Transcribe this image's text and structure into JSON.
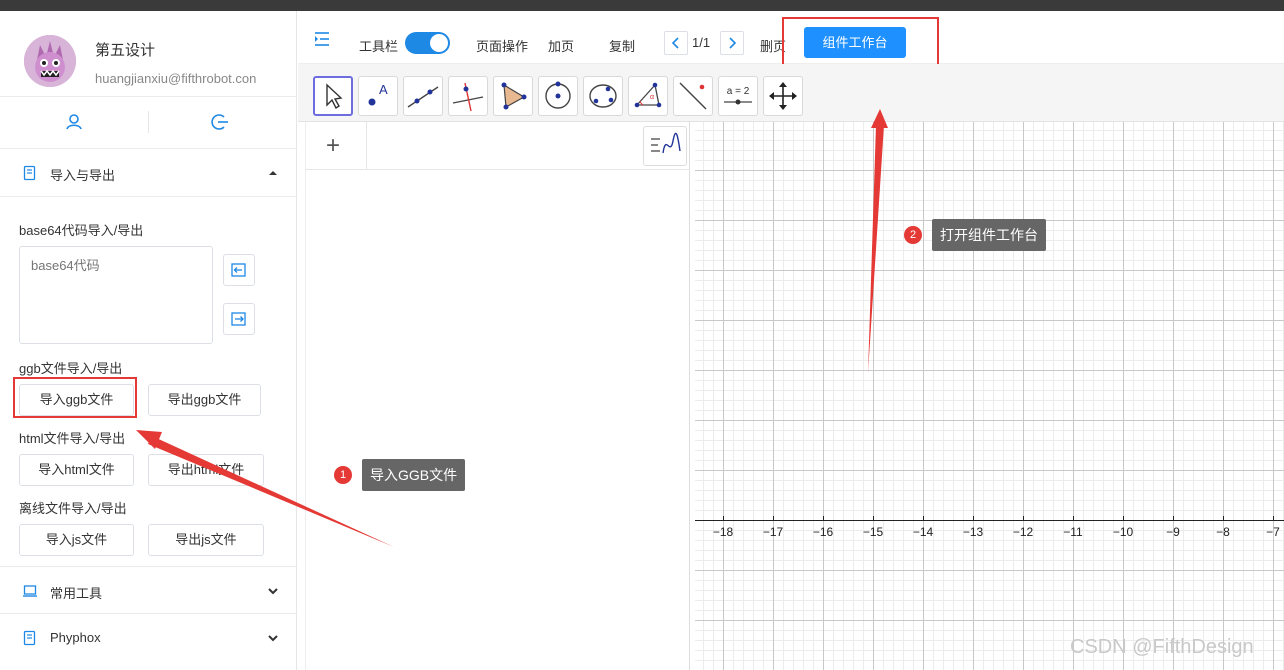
{
  "profile": {
    "name": "第五设计",
    "email": "huangjianxiu@fifthrobot.con"
  },
  "sidebar": {
    "import_export_title": "导入与导出",
    "base64_label": "base64代码导入/导出",
    "base64_placeholder": "base64代码",
    "ggb_label": "ggb文件导入/导出",
    "import_ggb": "导入ggb文件",
    "export_ggb": "导出ggb文件",
    "html_label": "html文件导入/导出",
    "import_html": "导入html文件",
    "export_html": "导出html文件",
    "offline_label": "离线文件导入/导出",
    "import_js": "导入js文件",
    "export_js": "导出js文件",
    "common_tools": "常用工具",
    "phyphox": "Phyphox"
  },
  "toolbar": {
    "toolbar_label": "工具栏",
    "page_ops": "页面操作",
    "add_page": "加页",
    "copy": "复制",
    "page_indicator": "1/1",
    "delete_page": "删页",
    "workbench": "组件工作台"
  },
  "tools": {
    "equation_label": "a = 2"
  },
  "axis": {
    "labels": [
      "−18",
      "−17",
      "−16",
      "−15",
      "−14",
      "−13",
      "−12",
      "−11",
      "−10",
      "−9",
      "−8",
      "−7"
    ]
  },
  "annotations": {
    "tip1_number": "1",
    "tip1_text": "导入GGB文件",
    "tip2_number": "2",
    "tip2_text": "打开组件工作台"
  },
  "watermark": "CSDN @FifthDesign",
  "colors": {
    "primary": "#1e90ff",
    "highlight": "#e53935"
  }
}
